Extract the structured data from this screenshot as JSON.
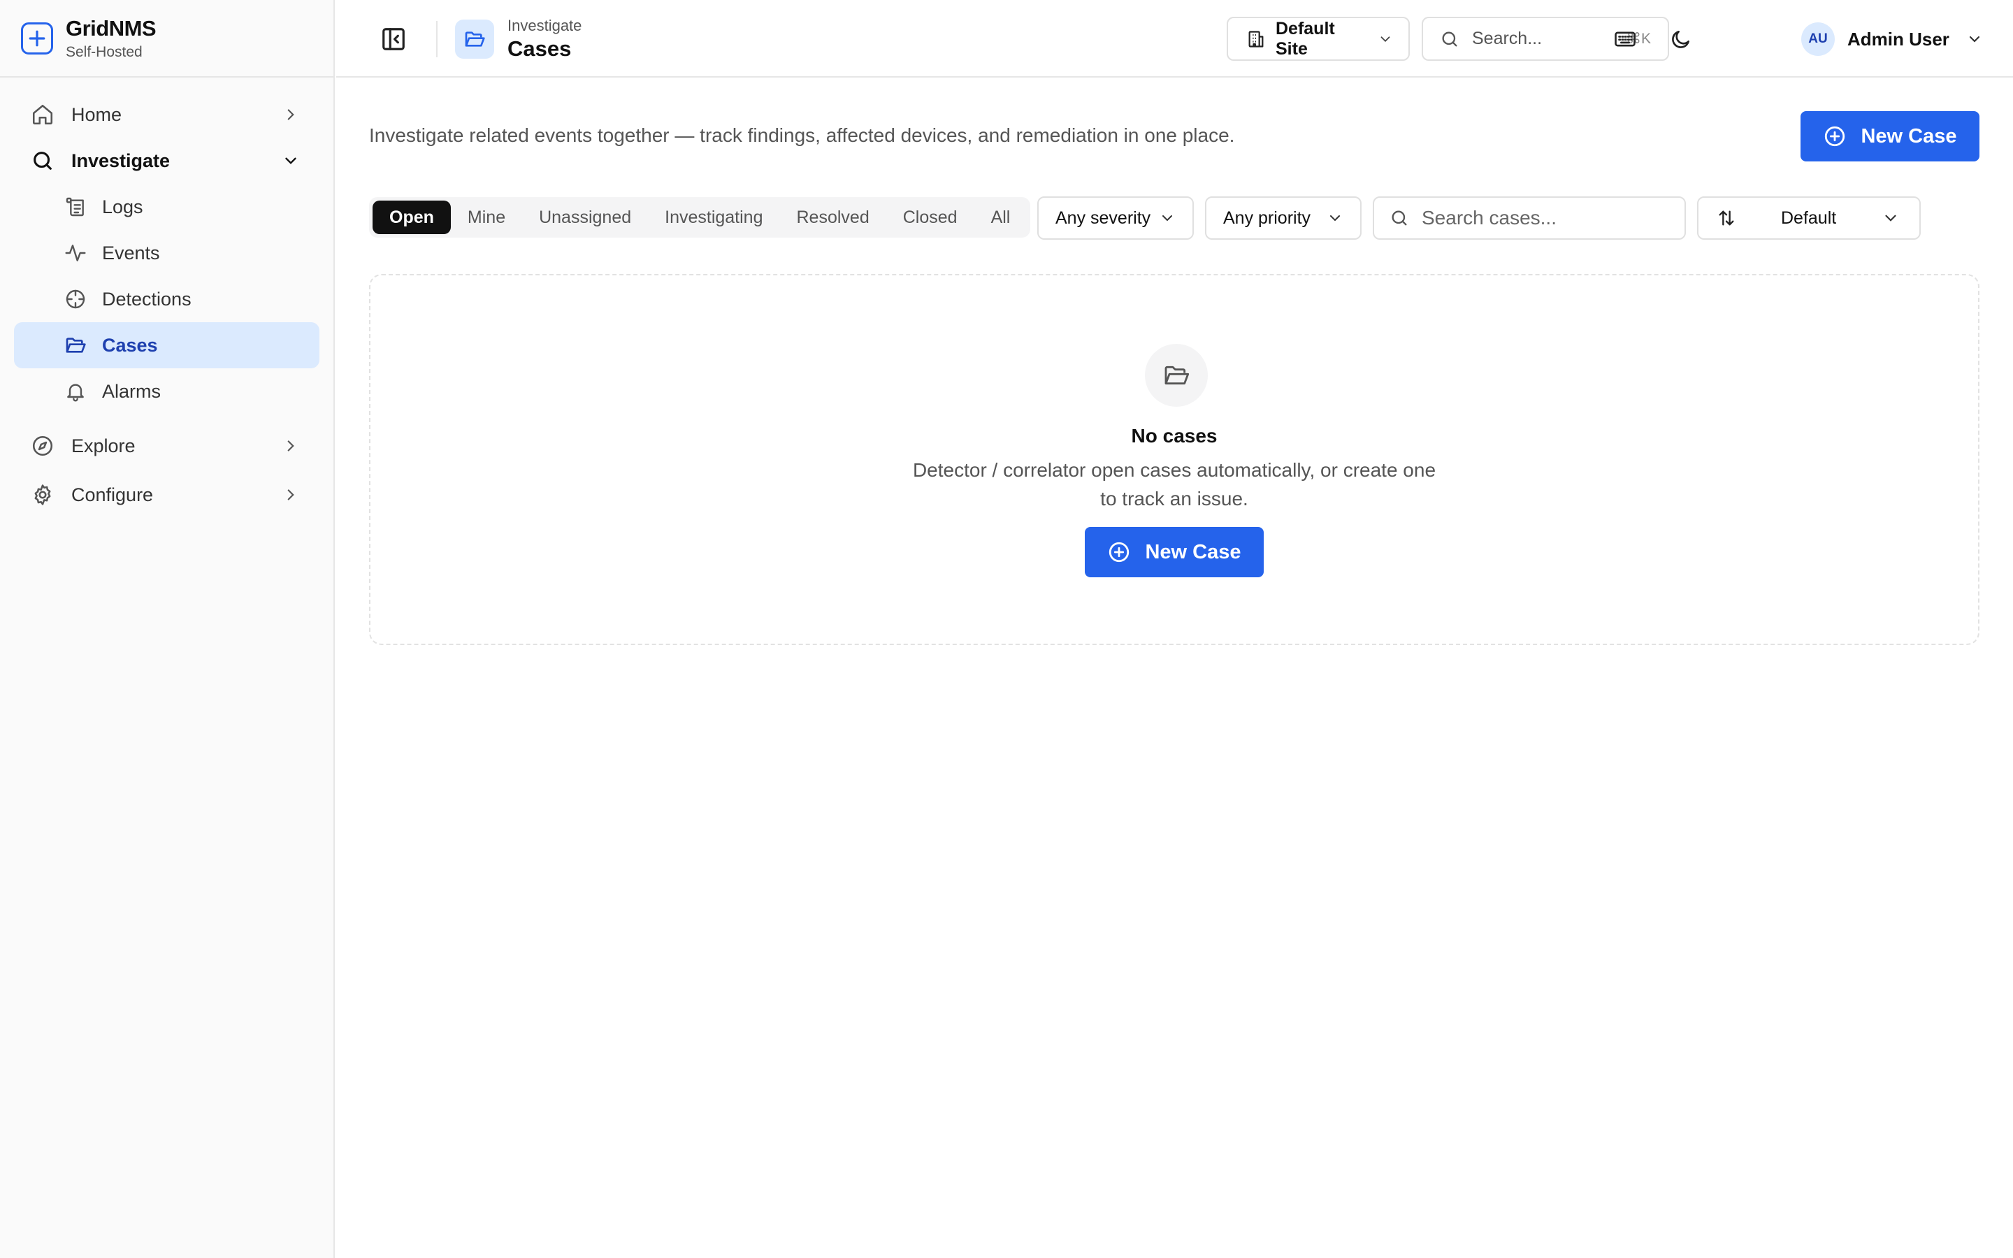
{
  "brand": {
    "name": "GridNMS",
    "subtitle": "Self-Hosted"
  },
  "sidebar": {
    "items": [
      {
        "label": "Home",
        "icon": "home-icon"
      },
      {
        "label": "Investigate",
        "icon": "search-icon",
        "expanded": true,
        "children": [
          {
            "label": "Logs",
            "icon": "logs-icon"
          },
          {
            "label": "Events",
            "icon": "activity-icon"
          },
          {
            "label": "Detections",
            "icon": "crosshair-icon"
          },
          {
            "label": "Cases",
            "icon": "folder-open-icon",
            "active": true
          },
          {
            "label": "Alarms",
            "icon": "bell-icon"
          }
        ]
      },
      {
        "label": "Explore",
        "icon": "compass-icon"
      },
      {
        "label": "Configure",
        "icon": "gear-icon"
      }
    ]
  },
  "header": {
    "breadcrumb_parent": "Investigate",
    "page_title": "Cases",
    "site_selector": "Default Site",
    "search_placeholder": "Search...",
    "search_shortcut": "⌘K",
    "user": {
      "initials": "AU",
      "name": "Admin User"
    }
  },
  "main": {
    "description": "Investigate related events together — track findings, affected devices, and remediation in one place.",
    "new_case_label": "New Case",
    "status_tabs": [
      "Open",
      "Mine",
      "Unassigned",
      "Investigating",
      "Resolved",
      "Closed",
      "All"
    ],
    "active_tab": "Open",
    "severity_filter": "Any severity",
    "priority_filter": "Any priority",
    "case_search_placeholder": "Search cases...",
    "sort_value": "Default",
    "empty_state": {
      "title": "No cases",
      "description": "Detector / correlator open cases automatically, or create one to track an issue.",
      "button_label": "New Case"
    }
  },
  "colors": {
    "accent": "#2563eb",
    "active_bg": "#dbeafe",
    "active_text": "#1e40af",
    "sidebar_bg": "#fafafa",
    "tab_active_bg": "#111111"
  }
}
